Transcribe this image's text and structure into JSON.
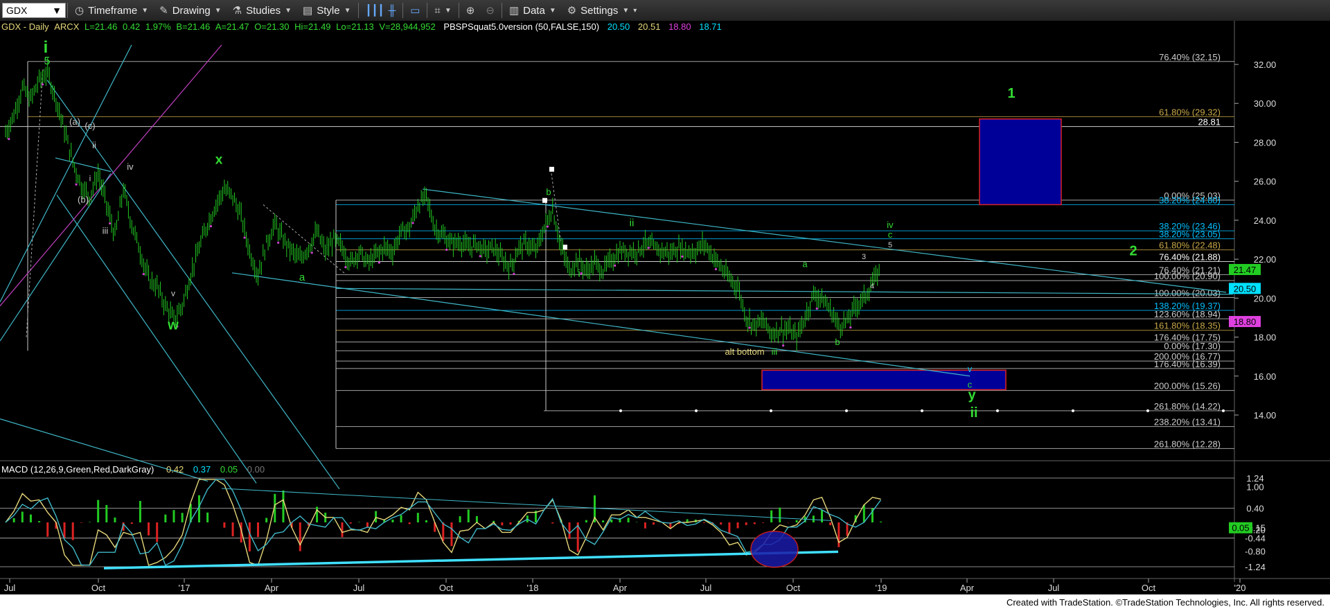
{
  "toolbar": {
    "symbol": "GDX",
    "timeframe": "Timeframe",
    "drawing": "Drawing",
    "studies": "Studies",
    "style": "Style",
    "data": "Data",
    "settings": "Settings"
  },
  "header": {
    "ticker": "GDX - Daily",
    "exchange": "ARCX",
    "last": "L=21.46",
    "change": "0.42",
    "change_pct": "1.97%",
    "bid": "B=21.46",
    "ask": "A=21.47",
    "open": "O=21.30",
    "high": "Hi=21.49",
    "low": "Lo=21.13",
    "volume": "V=28,944,952",
    "study": "PBSPSquat5.0version (50,FALSE,150)",
    "study_values": [
      {
        "text": "20.50",
        "color": "#00e0ff"
      },
      {
        "text": "20.51",
        "color": "#e6d77a"
      },
      {
        "text": "18.80",
        "color": "#e040e0"
      },
      {
        "text": "18.71",
        "color": "#00e0ff"
      }
    ]
  },
  "macd_header": {
    "label": "MACD (12,26,9,Green,Red,DarkGray)",
    "values": [
      {
        "text": "0.42",
        "color": "#e6d77a"
      },
      {
        "text": "0.37",
        "color": "#00e0ff"
      },
      {
        "text": "0.05",
        "color": "#33dd33"
      },
      {
        "text": "0.00",
        "color": "#777777"
      }
    ]
  },
  "footer": "Created with TradeStation. ©TradeStation Technologies, Inc. All rights reserved.",
  "chart_data": {
    "type": "line",
    "subtype": "candlestick-ohlc",
    "title": "GDX - Daily",
    "y_axis": {
      "ylim": [
        11.5,
        33.0
      ],
      "ticks": [
        14,
        16,
        18,
        20,
        22,
        24,
        26,
        28,
        30,
        32
      ],
      "position": "right"
    },
    "x_axis": {
      "tick_labels": [
        "Jul",
        "Oct",
        "'17",
        "Apr",
        "Jul",
        "Oct",
        "'18",
        "Apr",
        "Jul",
        "Oct",
        "'19",
        "Apr",
        "Jul",
        "Oct",
        "'20"
      ]
    },
    "price_path": [
      [
        0,
        28.5
      ],
      [
        10,
        29.4
      ],
      [
        20,
        30.8
      ],
      [
        30,
        30.2
      ],
      [
        40,
        31.2
      ],
      [
        50,
        31.6
      ],
      [
        60,
        30.2
      ],
      [
        70,
        28.6
      ],
      [
        80,
        27.0
      ],
      [
        90,
        25.8
      ],
      [
        100,
        25.2
      ],
      [
        110,
        26.4
      ],
      [
        120,
        24.8
      ],
      [
        130,
        23.2
      ],
      [
        140,
        25.6
      ],
      [
        150,
        23.8
      ],
      [
        160,
        22.4
      ],
      [
        170,
        21.0
      ],
      [
        180,
        20.6
      ],
      [
        190,
        19.6
      ],
      [
        200,
        18.9
      ],
      [
        210,
        19.6
      ],
      [
        220,
        21.2
      ],
      [
        230,
        22.6
      ],
      [
        240,
        23.8
      ],
      [
        250,
        24.8
      ],
      [
        260,
        25.6
      ],
      [
        270,
        25.2
      ],
      [
        280,
        24.2
      ],
      [
        290,
        22.4
      ],
      [
        300,
        21.2
      ],
      [
        310,
        22.8
      ],
      [
        320,
        23.8
      ],
      [
        330,
        23.0
      ],
      [
        340,
        22.4
      ],
      [
        350,
        22.0
      ],
      [
        360,
        22.6
      ],
      [
        370,
        23.4
      ],
      [
        380,
        22.4
      ],
      [
        390,
        23.0
      ],
      [
        400,
        22.6
      ],
      [
        410,
        21.8
      ],
      [
        420,
        22.4
      ],
      [
        430,
        21.8
      ],
      [
        440,
        22.2
      ],
      [
        450,
        22.6
      ],
      [
        460,
        22.4
      ],
      [
        470,
        23.4
      ],
      [
        480,
        23.6
      ],
      [
        490,
        24.8
      ],
      [
        500,
        25.2
      ],
      [
        510,
        23.6
      ],
      [
        520,
        23.2
      ],
      [
        530,
        22.8
      ],
      [
        540,
        22.9
      ],
      [
        550,
        22.6
      ],
      [
        560,
        22.8
      ],
      [
        570,
        22.4
      ],
      [
        580,
        22.6
      ],
      [
        590,
        22.0
      ],
      [
        600,
        21.6
      ],
      [
        610,
        22.6
      ],
      [
        620,
        22.8
      ],
      [
        630,
        22.4
      ],
      [
        640,
        23.6
      ],
      [
        650,
        24.6
      ],
      [
        660,
        22.6
      ],
      [
        670,
        21.4
      ],
      [
        680,
        22.0
      ],
      [
        690,
        21.4
      ],
      [
        700,
        21.8
      ],
      [
        710,
        21.4
      ],
      [
        720,
        22.0
      ],
      [
        730,
        22.4
      ],
      [
        740,
        22.4
      ],
      [
        750,
        22.4
      ],
      [
        760,
        22.8
      ],
      [
        770,
        22.6
      ],
      [
        780,
        22.4
      ],
      [
        790,
        22.3
      ],
      [
        800,
        22.6
      ],
      [
        810,
        22.4
      ],
      [
        820,
        22.4
      ],
      [
        830,
        22.8
      ],
      [
        840,
        22.2
      ],
      [
        850,
        21.6
      ],
      [
        860,
        21.0
      ],
      [
        870,
        20.6
      ],
      [
        880,
        19.0
      ],
      [
        890,
        18.6
      ],
      [
        900,
        18.8
      ],
      [
        910,
        18.2
      ],
      [
        920,
        18.4
      ],
      [
        930,
        18.4
      ],
      [
        940,
        18.0
      ],
      [
        950,
        19.0
      ],
      [
        960,
        20.2
      ],
      [
        970,
        20.0
      ],
      [
        980,
        19.4
      ],
      [
        990,
        18.6
      ],
      [
        1000,
        18.8
      ],
      [
        1010,
        19.6
      ],
      [
        1020,
        20.0
      ],
      [
        1030,
        20.8
      ],
      [
        1040,
        21.46
      ]
    ],
    "fib_levels": [
      {
        "label": "76.40% (32.15)",
        "value": 32.15,
        "color": "#cccccc"
      },
      {
        "label": "61.80% (29.32)",
        "value": 29.32,
        "color": "#c8a848"
      },
      {
        "label": "28.81",
        "value": 28.81,
        "color": "#ffffff"
      },
      {
        "label": "0.00% (25.03)",
        "value": 25.03,
        "color": "#cccccc"
      },
      {
        "label": "38.20% (24.80)",
        "value": 24.8,
        "color": "#00bfff"
      },
      {
        "label": "38.20% (23.46)",
        "value": 23.46,
        "color": "#00bfff"
      },
      {
        "label": "38.20% (23.05)",
        "value": 23.05,
        "color": "#00bfff"
      },
      {
        "label": "61.80% (22.48)",
        "value": 22.48,
        "color": "#c8a848"
      },
      {
        "label": "76.40% (21.88)",
        "value": 21.88,
        "color": "#ffffff"
      },
      {
        "label": "76.40% (21.21)",
        "value": 21.21,
        "color": "#cccccc"
      },
      {
        "label": "100.00% (20.90)",
        "value": 20.9,
        "color": "#cccccc"
      },
      {
        "label": "100.00% (20.03)",
        "value": 20.03,
        "color": "#cccccc"
      },
      {
        "label": "138.20% (19.37)",
        "value": 19.37,
        "color": "#00bfff"
      },
      {
        "label": "123.60% (18.94)",
        "value": 18.94,
        "color": "#cccccc"
      },
      {
        "label": "161.80% (18.35)",
        "value": 18.35,
        "color": "#c8a848"
      },
      {
        "label": "176.40% (17.75)",
        "value": 17.75,
        "color": "#cccccc"
      },
      {
        "label": "0.00% (17.30)",
        "value": 17.3,
        "color": "#cccccc"
      },
      {
        "label": "200.00% (16.77)",
        "value": 16.77,
        "color": "#cccccc"
      },
      {
        "label": "176.40% (16.39)",
        "value": 16.39,
        "color": "#cccccc"
      },
      {
        "label": "200.00% (15.26)",
        "value": 15.26,
        "color": "#cccccc"
      },
      {
        "label": "261.80% (14.22)",
        "value": 14.22,
        "color": "#cccccc"
      },
      {
        "label": "238.20% (13.41)",
        "value": 13.41,
        "color": "#cccccc"
      },
      {
        "label": "261.80% (12.28)",
        "value": 12.28,
        "color": "#cccccc"
      }
    ],
    "price_badges": [
      {
        "text": "21.47",
        "value": 21.47,
        "color": "#22cc22",
        "text_color": "#000000"
      },
      {
        "text": "20.50",
        "value": 20.5,
        "color": "#00e0ff",
        "text_color": "#000000"
      },
      {
        "text": "18.80",
        "value": 18.8,
        "color": "#e040e0",
        "text_color": "#000000"
      }
    ],
    "wave_labels": [
      {
        "text": "i",
        "color": "#33dd33"
      },
      {
        "text": "5",
        "color": "#33dd33"
      },
      {
        "text": "(a)",
        "color": "#cccccc"
      },
      {
        "text": "(c)",
        "color": "#cccccc"
      },
      {
        "text": "ii",
        "color": "#cccccc"
      },
      {
        "text": "i",
        "color": "#cccccc"
      },
      {
        "text": "(b)",
        "color": "#cccccc"
      },
      {
        "text": "iv",
        "color": "#cccccc"
      },
      {
        "text": "iii",
        "color": "#cccccc"
      },
      {
        "text": "v",
        "color": "#cccccc"
      },
      {
        "text": "w",
        "color": "#33dd33"
      },
      {
        "text": "x",
        "color": "#33dd33"
      },
      {
        "text": "a",
        "color": "#33dd33"
      },
      {
        "text": "b",
        "color": "#33dd33"
      },
      {
        "text": "i",
        "color": "#33dd33"
      },
      {
        "text": "ii",
        "color": "#33dd33"
      },
      {
        "text": "a",
        "color": "#33dd33"
      },
      {
        "text": "b",
        "color": "#33dd33"
      },
      {
        "text": "iii",
        "color": "#33dd33"
      },
      {
        "text": "alt bottom",
        "color": "#e6d77a"
      },
      {
        "text": "3",
        "color": "#cccccc"
      },
      {
        "text": "4",
        "color": "#cccccc"
      },
      {
        "text": "5",
        "color": "#cccccc"
      },
      {
        "text": "c",
        "color": "#33dd33"
      },
      {
        "text": "iv",
        "color": "#33dd33"
      },
      {
        "text": "v",
        "color": "#00bfff"
      },
      {
        "text": "c",
        "color": "#33dd33"
      },
      {
        "text": "y",
        "color": "#33dd33"
      },
      {
        "text": "ii",
        "color": "#33dd33"
      },
      {
        "text": "1",
        "color": "#33dd33"
      },
      {
        "text": "2",
        "color": "#33dd33"
      }
    ],
    "target_boxes": [
      {
        "name": "wave-1-target",
        "y_range": [
          24.8,
          29.2
        ],
        "color": "#000099"
      },
      {
        "name": "wave-ii-target",
        "y_range": [
          15.3,
          16.3
        ],
        "color": "#000099"
      }
    ],
    "macd": {
      "y_axis": {
        "ylim": [
          -1.35,
          1.35
        ],
        "ticks": [
          1.24,
          1.0,
          0.4,
          -0.15,
          -0.2,
          -0.44,
          -0.8,
          -1.24
        ]
      },
      "badge": {
        "text": "0.05",
        "color": "#22cc22"
      }
    }
  }
}
